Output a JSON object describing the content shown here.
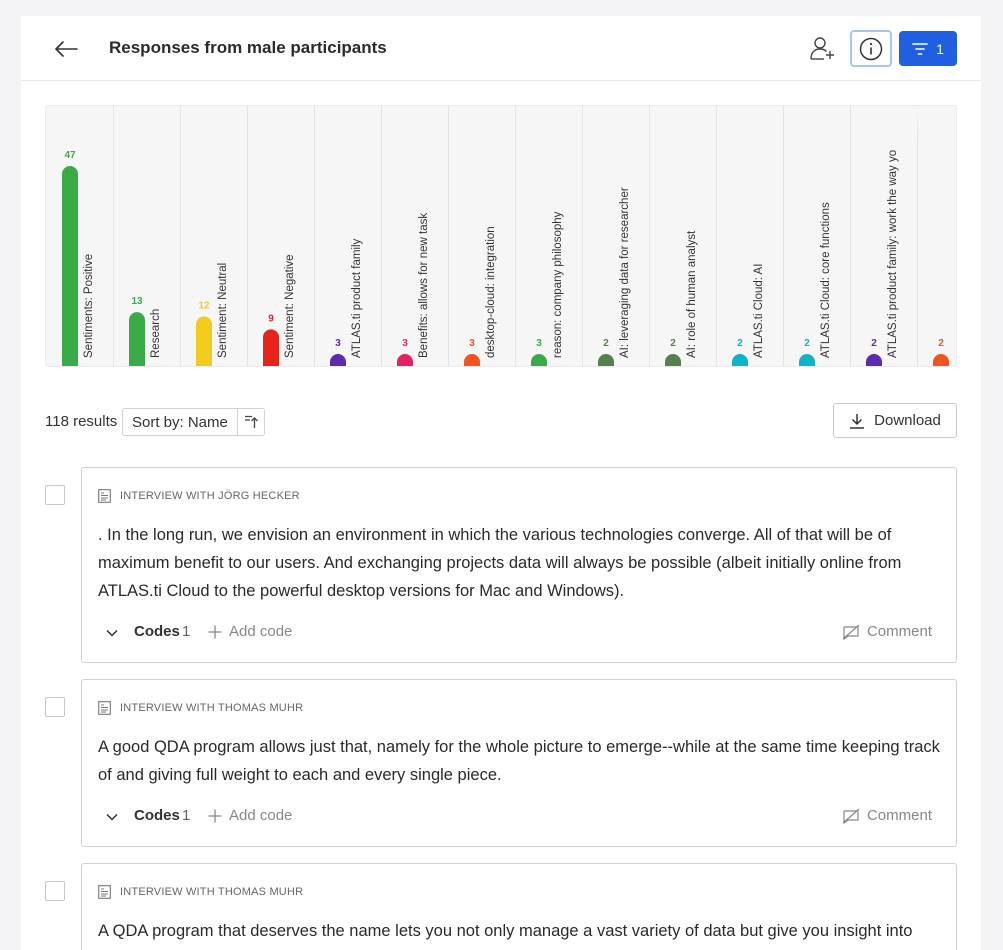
{
  "header": {
    "title": "Responses from male participants",
    "filter_count": "1"
  },
  "icons": {
    "back": "arrow-left-icon",
    "add_user": "add-user-icon",
    "info": "info-icon",
    "filter": "filter-icon",
    "download": "download-icon",
    "sort_direction": "sort-ascending-icon",
    "document": "document-icon",
    "chevron": "chevron-down-icon",
    "plus": "plus-icon",
    "comment": "comment-hidden-icon"
  },
  "chart_data": {
    "type": "bar",
    "categories": [
      "Sentiments: Positive",
      "Research",
      "Sentiment: Neutral",
      "Sentiment: Negative",
      "ATLAS.ti product family",
      "Benefits: allows for new task",
      "desktop-cloud: integration",
      "reason: company philosophy",
      "AI: leveraging data for researcher",
      "AI: role of human analyst",
      "ATLAS.ti Cloud: AI",
      "ATLAS.ti Cloud: core functions",
      "ATLAS.ti product family: work the way yo",
      ""
    ],
    "values": [
      47,
      13,
      12,
      9,
      3,
      3,
      3,
      3,
      2,
      2,
      2,
      2,
      2,
      2
    ],
    "colors": [
      "#3aaa47",
      "#3aaa47",
      "#f2cc1d",
      "#e8231c",
      "#5f2ab0",
      "#e3225f",
      "#f4521e",
      "#3aaa47",
      "#557f4e",
      "#557f4e",
      "#0fb3c9",
      "#0fb3c9",
      "#5f2ab0",
      "#f4521e"
    ],
    "grid": false,
    "legend": "none"
  },
  "results": {
    "count_text": "118 results",
    "sort_label": "Sort by: Name",
    "download_label": "Download"
  },
  "cards": [
    {
      "source": "INTERVIEW WITH JÖRG HECKER",
      "text": ". In the long run, we envision an environment in which the various technologies converge. All of that will be of maximum benefit to our users. And exchanging projects data will always be possible (albeit initially online from ATLAS.ti Cloud to the powerful desktop versions for Mac and Windows).",
      "codes_label": "Codes",
      "codes_count": "1",
      "add_code_label": "Add code",
      "comment_label": "Comment"
    },
    {
      "source": "INTERVIEW WITH THOMAS MUHR",
      "text": "A good QDA program allows just that, namely for the whole picture to emerge--while at the same time keeping track of and giving full weight to each and every single piece.",
      "codes_label": "Codes",
      "codes_count": "1",
      "add_code_label": "Add code",
      "comment_label": "Comment"
    },
    {
      "source": "INTERVIEW WITH THOMAS MUHR",
      "text": "A QDA program that deserves the name lets you not only manage a vast variety of data but give you insight into"
    }
  ]
}
